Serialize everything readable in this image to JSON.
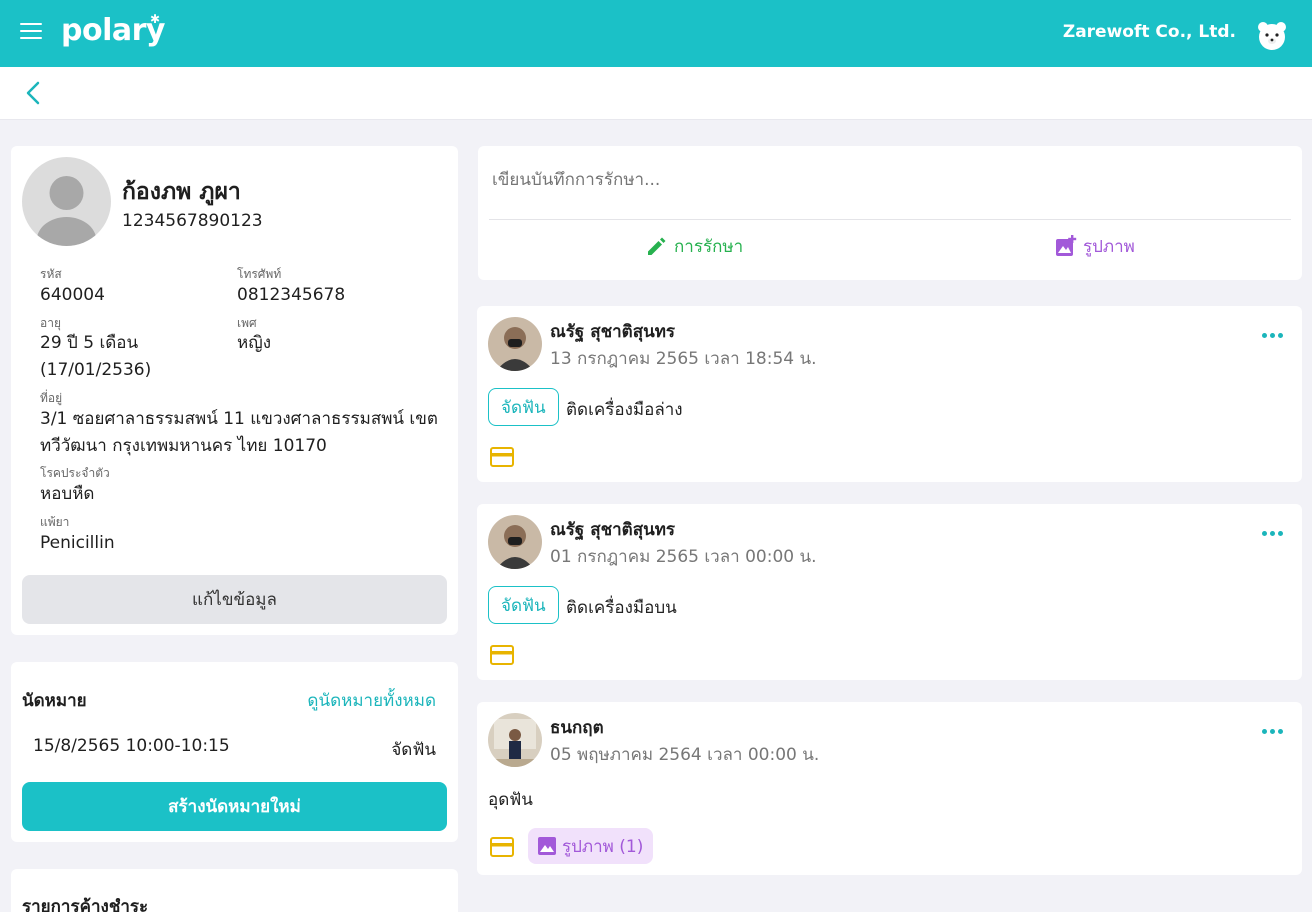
{
  "header": {
    "logo": "polary",
    "company": "Zarewoft Co., Ltd."
  },
  "patient": {
    "name": "ก้องภพ ภูผา",
    "id_number": "1234567890123",
    "fields": {
      "code_label": "รหัส",
      "code": "640004",
      "phone_label": "โทรศัพท์",
      "phone": "0812345678",
      "age_label": "อายุ",
      "age": "29 ปี 5 เดือน",
      "birth": "(17/01/2536)",
      "gender_label": "เพศ",
      "gender": "หญิง",
      "address_label": "ที่อยู่",
      "address_line1": "3/1 ซอยศาลาธรรมสพน์ 11 แขวงศาลาธรรมสพน์ เขต",
      "address_line2": "ทวีวัฒนา กรุงเทพมหานคร ไทย 10170",
      "disease_label": "โรคประจำตัว",
      "disease": "หอบหืด",
      "allergy_label": "แพ้ยา",
      "allergy": "Penicillin"
    },
    "edit_label": "แก้ไขข้อมูล"
  },
  "appointments": {
    "title": "นัดหมาย",
    "view_all": "ดูนัดหมายทั้งหมด",
    "item_time": "15/8/2565 10:00-10:15",
    "item_type": "จัดฟัน",
    "create_label": "สร้างนัดหมายใหม่"
  },
  "pending": {
    "title": "รายการค้างชำระ"
  },
  "composer": {
    "placeholder": "เขียนบันทึกการรักษา...",
    "treatment_label": "การรักษา",
    "photo_label": "รูปภาพ"
  },
  "posts": [
    {
      "author": "ณรัฐ สุชาติสุนทร",
      "date": "13 กรกฎาคม 2565 เวลา 18:54 น.",
      "tag": "จัดฟัน",
      "text": "ติดเครื่องมือล่าง"
    },
    {
      "author": "ณรัฐ สุชาติสุนทร",
      "date": "01 กรกฎาคม 2565 เวลา 00:00 น.",
      "tag": "จัดฟัน",
      "text": "ติดเครื่องมือบน"
    },
    {
      "author": "ธนกฤต",
      "date": "05 พฤษภาคม 2564 เวลา 00:00 น.",
      "text": "อุดฟัน",
      "images_label": "รูปภาพ (1)"
    }
  ],
  "colors": {
    "primary": "#1bc1c7",
    "treatment": "#27b14f",
    "photo": "#a259d9",
    "payment": "#e8b400"
  }
}
